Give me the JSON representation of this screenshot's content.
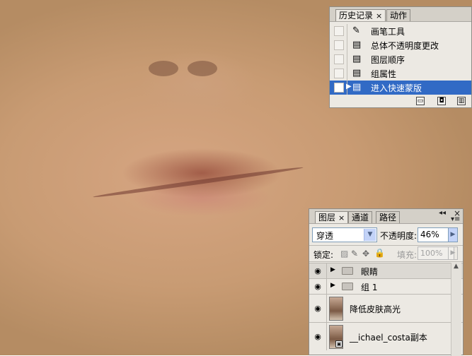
{
  "history_panel": {
    "tabs": [
      {
        "label": "历史记录",
        "close": "×"
      },
      {
        "label": "动作"
      }
    ],
    "items": [
      {
        "label": "画笔工具",
        "icon": "brush-icon"
      },
      {
        "label": "总体不透明度更改",
        "icon": "document-icon"
      },
      {
        "label": "图层顺序",
        "icon": "document-icon"
      },
      {
        "label": "组属性",
        "icon": "document-icon"
      },
      {
        "label": "进入快速蒙版",
        "icon": "document-icon",
        "selected": true
      }
    ]
  },
  "layers_panel": {
    "tabs": [
      {
        "label": "图层",
        "close": "×"
      },
      {
        "label": "通道"
      },
      {
        "label": "路径"
      }
    ],
    "blend_mode": "穿透",
    "opacity_label": "不透明度:",
    "opacity_value": "46%",
    "lock_label": "锁定:",
    "fill_label": "填充:",
    "fill_value": "100%",
    "layers": [
      {
        "name": "眼睛",
        "type": "group"
      },
      {
        "name": "组 1",
        "type": "group"
      },
      {
        "name": "降低皮肤高光",
        "type": "layer"
      },
      {
        "name": "__ichael_costa副本",
        "type": "layer"
      }
    ]
  },
  "colors": {
    "selection": "#316ac5",
    "panel_bg": "#ece9e3"
  }
}
